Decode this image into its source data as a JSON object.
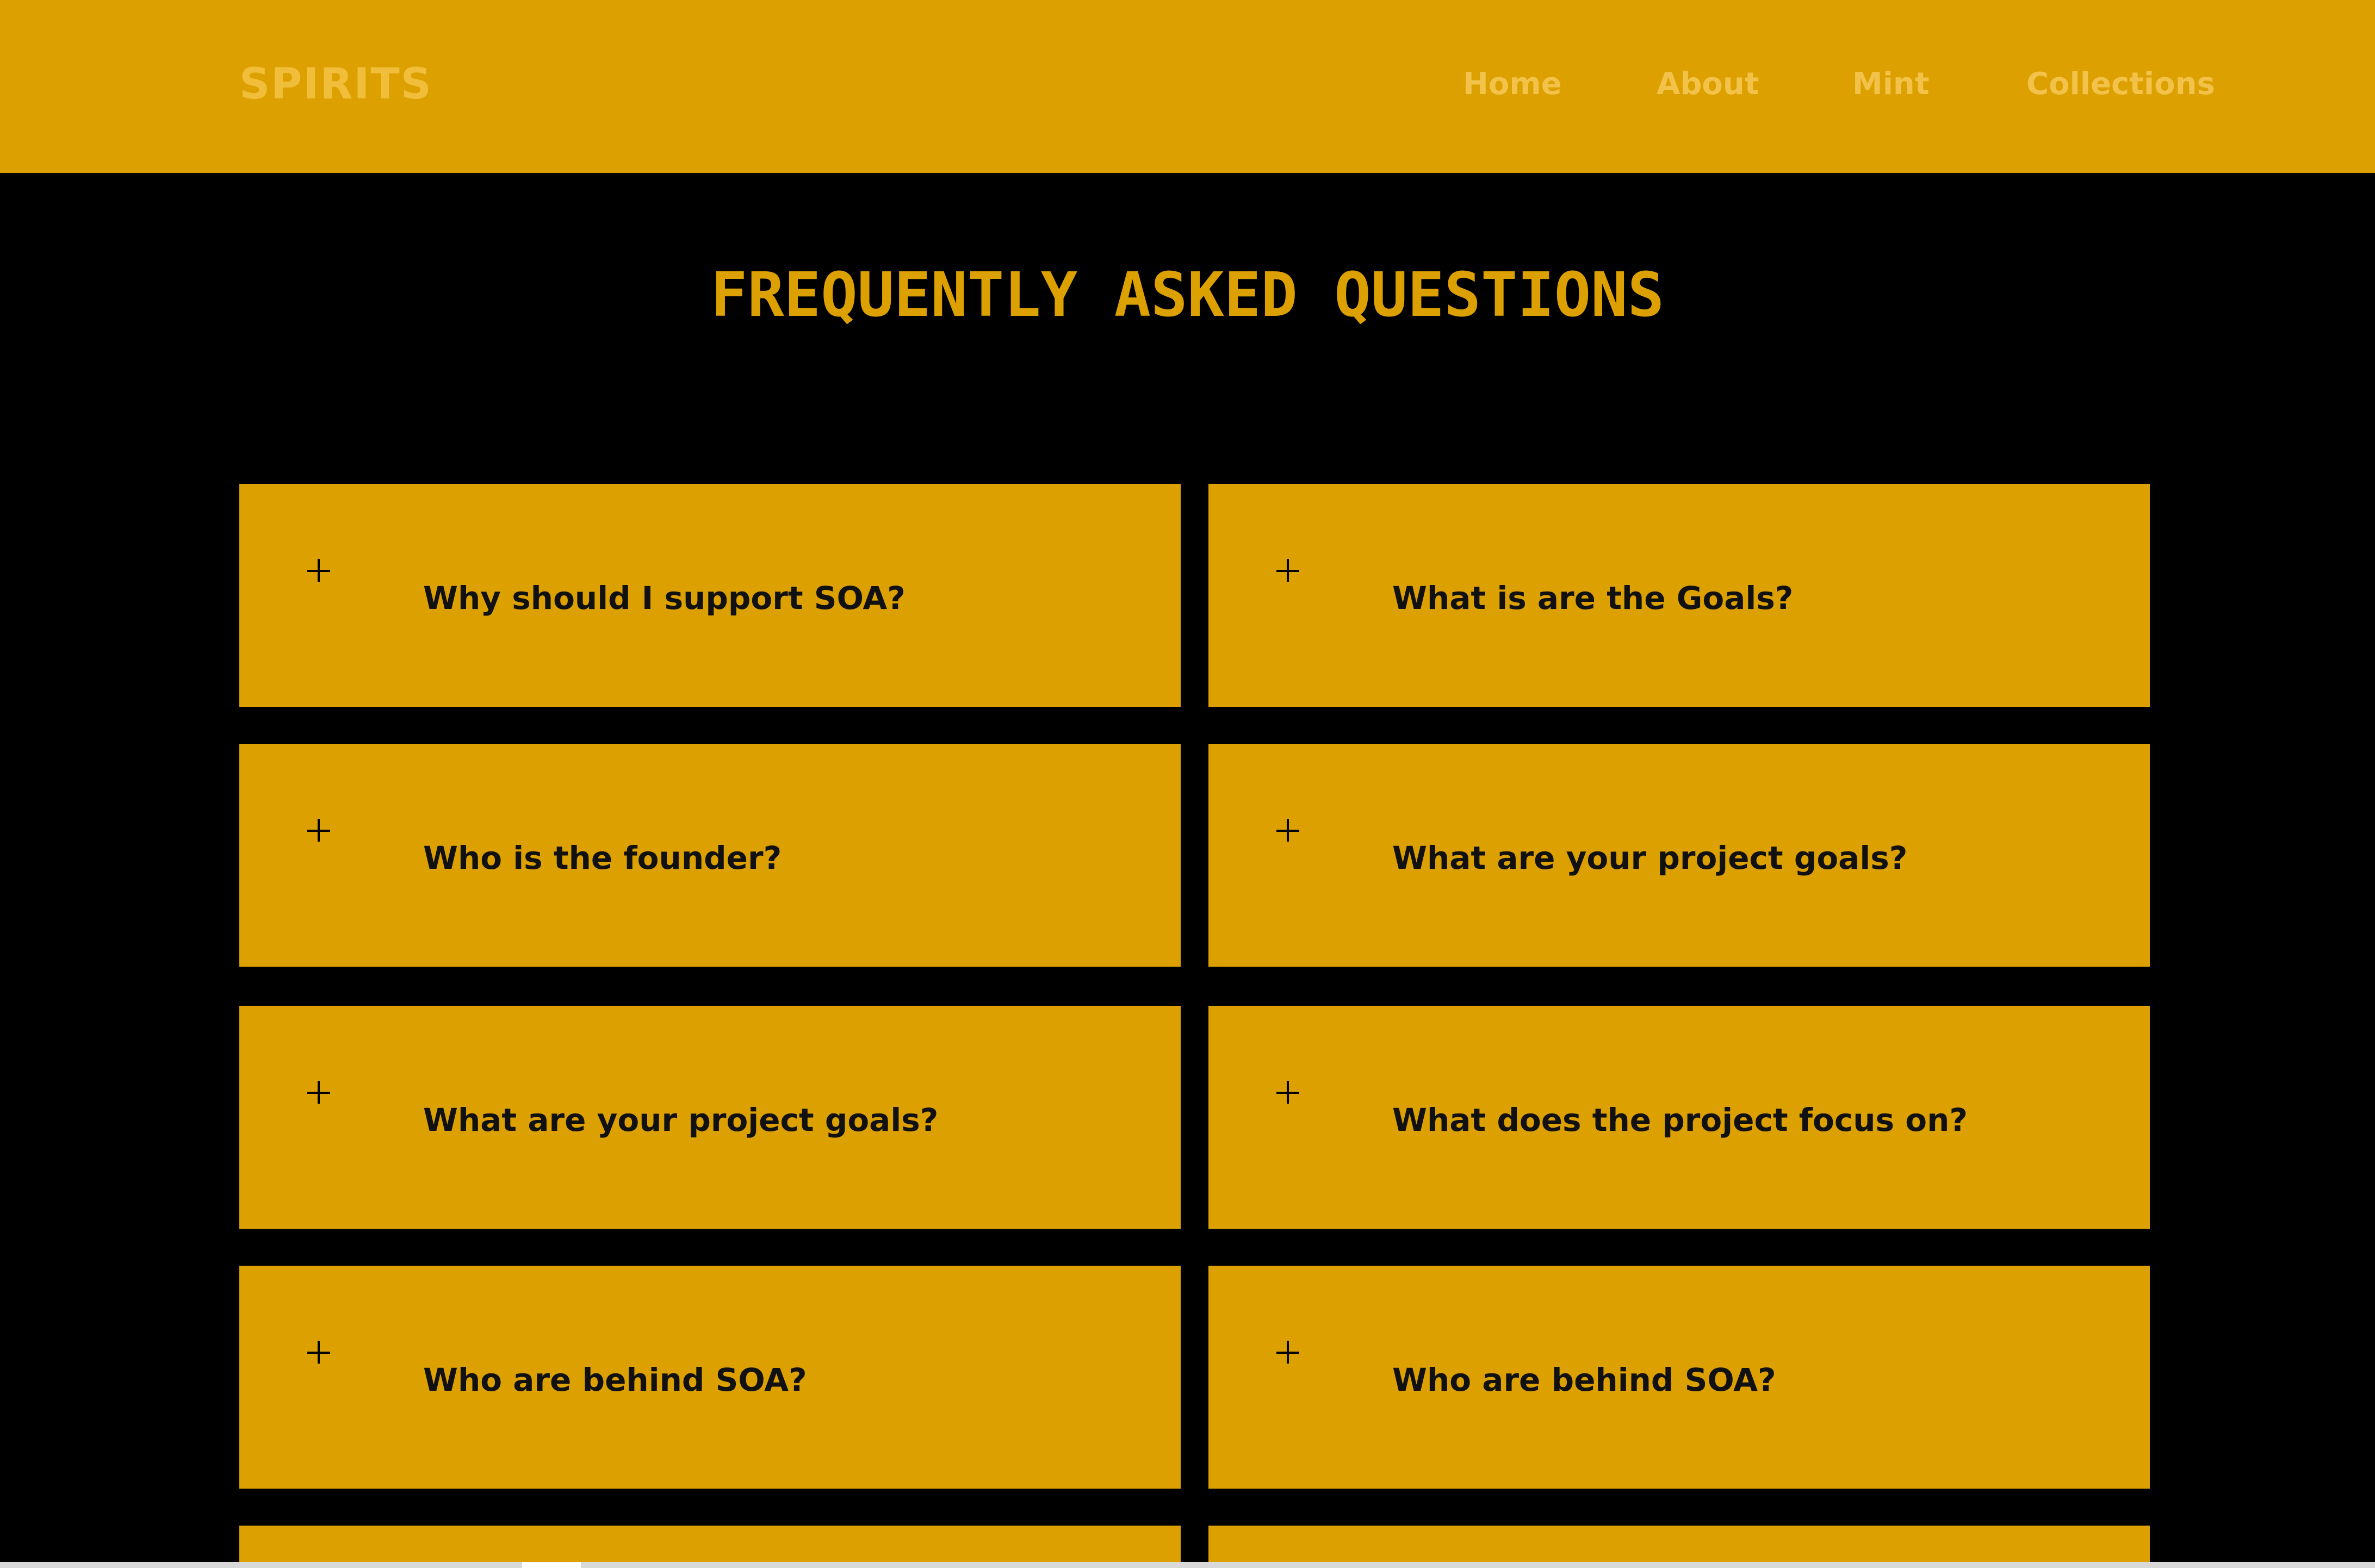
{
  "brand": {
    "logo_text": "SPIRITS"
  },
  "nav": {
    "items": [
      {
        "label": "Home"
      },
      {
        "label": "About"
      },
      {
        "label": "Mint"
      },
      {
        "label": "Collections"
      }
    ]
  },
  "faq": {
    "title": "FREQUENTLY ASKED QUESTIONS",
    "items": [
      {
        "question": "Why should I support SOA?"
      },
      {
        "question": "What is are the Goals?"
      },
      {
        "question": "Who is the founder?"
      },
      {
        "question": "What are your project goals?"
      },
      {
        "question": "What are your project goals?"
      },
      {
        "question": "What does the project focus on?"
      },
      {
        "question": "Who are behind SOA?"
      },
      {
        "question": "Who are behind SOA?"
      }
    ]
  },
  "colors": {
    "accent": "#DCA000",
    "background": "#000000",
    "nav_text": "#F2C24A",
    "question_text": "#111111"
  },
  "icons": {
    "expand": "plus-icon"
  }
}
